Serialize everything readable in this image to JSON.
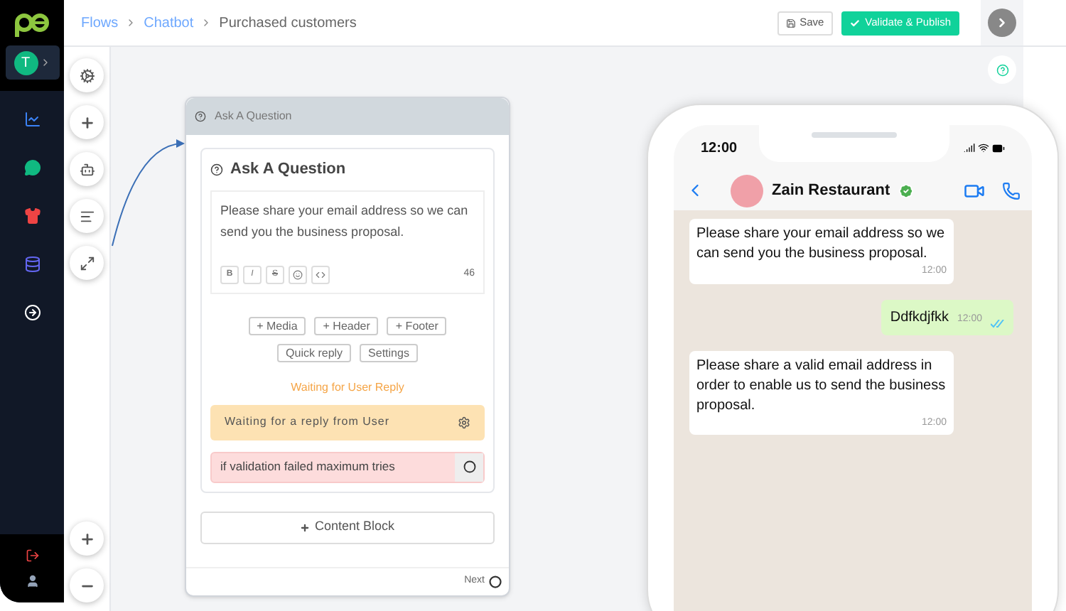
{
  "breadcrumb": [
    {
      "label": "Flows",
      "kind": "link"
    },
    {
      "label": "Chatbot",
      "kind": "link"
    },
    {
      "label": "Purchased customers",
      "kind": "current"
    }
  ],
  "user": {
    "initial": "T"
  },
  "actions": [
    {
      "label": "Save",
      "kind": "save"
    },
    {
      "label": "Validate & Publish",
      "kind": "publish"
    }
  ],
  "node": {
    "header": "Ask A Question",
    "title": "Ask A Question",
    "message": "Please share your email address so we can send you the business proposal.",
    "format_buttons": [
      "B",
      "I",
      "S"
    ],
    "char_count": "46",
    "add_buttons": [
      "+ Media",
      "+ Header",
      "+ Footer"
    ],
    "option_buttons": [
      "Quick reply",
      "Settings"
    ],
    "waiting_label": "Waiting for User Reply",
    "waiting_box": "Waiting for a reply from User",
    "validation_box": "if validation failed maximum tries",
    "content_block": "Content Block",
    "next": "Next"
  },
  "phone": {
    "time": "12:00",
    "contact": "Zain Restaurant",
    "messages": [
      {
        "kind": "incoming",
        "text": "Please share your email address so we can send you the business proposal.",
        "time": "12:00"
      },
      {
        "kind": "outgoing",
        "text": "Ddfkdjfkk",
        "time": "12:00"
      },
      {
        "kind": "incoming",
        "text": "Please share a valid email address in order to enable us to send the business proposal.",
        "time": "12:00"
      }
    ]
  }
}
